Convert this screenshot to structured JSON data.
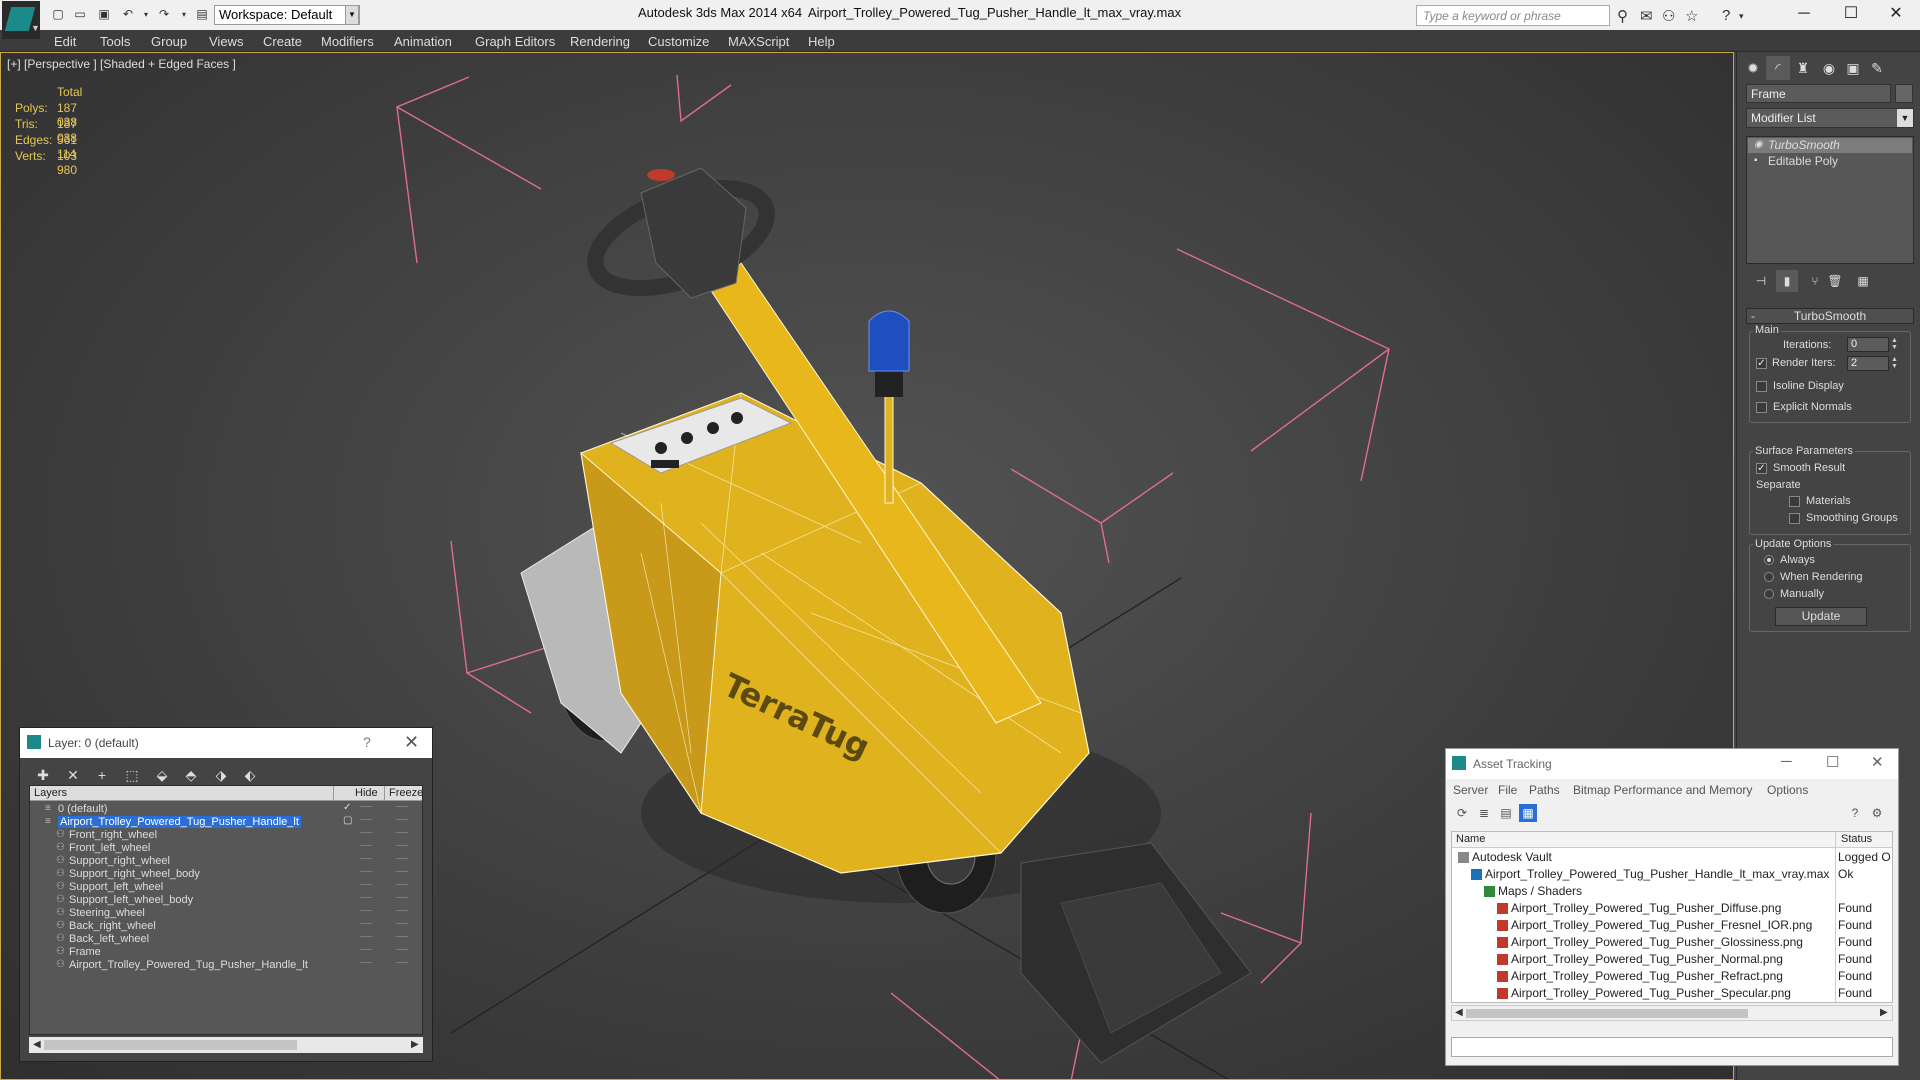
{
  "titlebar": {
    "workspace": "Workspace: Default",
    "app_title": "Autodesk 3ds Max  2014 x64",
    "file_title": "Airport_Trolley_Powered_Tug_Pusher_Handle_lt_max_vray.max",
    "search_placeholder": "Type a keyword or phrase"
  },
  "menu": [
    "Edit",
    "Tools",
    "Group",
    "Views",
    "Create",
    "Modifiers",
    "Animation",
    "Graph Editors",
    "Rendering",
    "Customize",
    "MAXScript",
    "Help"
  ],
  "viewport": {
    "label": "[+] [Perspective ] [Shaded + Edged Faces ]",
    "stats": {
      "header": "Total",
      "rows": [
        {
          "label": "Polys:",
          "value": "187 038"
        },
        {
          "label": "Tris:",
          "value": "187 038"
        },
        {
          "label": "Edges:",
          "value": "561 114"
        },
        {
          "label": "Verts:",
          "value": "103 980"
        }
      ]
    },
    "model_decal": "TerraTug"
  },
  "command_panel": {
    "object_name": "Frame",
    "modifier_list": "Modifier List",
    "stack": [
      "TurboSmooth",
      "Editable Poly"
    ],
    "turbosmooth": {
      "title": "TurboSmooth",
      "main_group": "Main",
      "iterations_label": "Iterations:",
      "iterations_value": "0",
      "render_iters_label": "Render Iters:",
      "render_iters_value": "2",
      "isoline": "Isoline Display",
      "explicit": "Explicit Normals",
      "surface_group": "Surface Parameters",
      "smooth_result": "Smooth Result",
      "separate": "Separate",
      "materials": "Materials",
      "smoothing_groups": "Smoothing Groups",
      "update_group": "Update Options",
      "always": "Always",
      "when_rendering": "When Rendering",
      "manually": "Manually",
      "update_button": "Update"
    }
  },
  "layer_dialog": {
    "title": "Layer: 0 (default)",
    "columns": [
      "Layers",
      "Hide",
      "Freeze"
    ],
    "rows": [
      {
        "name": "0 (default)",
        "level": 0,
        "selected": false
      },
      {
        "name": "Airport_Trolley_Powered_Tug_Pusher_Handle_lt",
        "level": 0,
        "selected": true
      },
      {
        "name": "Front_right_wheel",
        "level": 1,
        "selected": false
      },
      {
        "name": "Front_left_wheel",
        "level": 1,
        "selected": false
      },
      {
        "name": "Support_right_wheel",
        "level": 1,
        "selected": false
      },
      {
        "name": "Support_right_wheel_body",
        "level": 1,
        "selected": false
      },
      {
        "name": "Support_left_wheel",
        "level": 1,
        "selected": false
      },
      {
        "name": "Support_left_wheel_body",
        "level": 1,
        "selected": false
      },
      {
        "name": "Steering_wheel",
        "level": 1,
        "selected": false
      },
      {
        "name": "Back_right_wheel",
        "level": 1,
        "selected": false
      },
      {
        "name": "Back_left_wheel",
        "level": 1,
        "selected": false
      },
      {
        "name": "Frame",
        "level": 1,
        "selected": false
      },
      {
        "name": "Airport_Trolley_Powered_Tug_Pusher_Handle_lt",
        "level": 1,
        "selected": false
      }
    ]
  },
  "asset_tracking": {
    "title": "Asset Tracking",
    "menu": [
      "Server",
      "File",
      "Paths",
      "Bitmap Performance and Memory",
      "Options"
    ],
    "columns": [
      "Name",
      "Status"
    ],
    "rows": [
      {
        "name": "Autodesk Vault",
        "status": "Logged O",
        "level": 0
      },
      {
        "name": "Airport_Trolley_Powered_Tug_Pusher_Handle_lt_max_vray.max",
        "status": "Ok",
        "level": 1
      },
      {
        "name": "Maps / Shaders",
        "status": "",
        "level": 2
      },
      {
        "name": "Airport_Trolley_Powered_Tug_Pusher_Diffuse.png",
        "status": "Found",
        "level": 3
      },
      {
        "name": "Airport_Trolley_Powered_Tug_Pusher_Fresnel_IOR.png",
        "status": "Found",
        "level": 3
      },
      {
        "name": "Airport_Trolley_Powered_Tug_Pusher_Glossiness.png",
        "status": "Found",
        "level": 3
      },
      {
        "name": "Airport_Trolley_Powered_Tug_Pusher_Normal.png",
        "status": "Found",
        "level": 3
      },
      {
        "name": "Airport_Trolley_Powered_Tug_Pusher_Refract.png",
        "status": "Found",
        "level": 3
      },
      {
        "name": "Airport_Trolley_Powered_Tug_Pusher_Specular.png",
        "status": "Found",
        "level": 3
      }
    ]
  },
  "colors": {
    "accent": "#1d8a8a",
    "selection": "#2b6fd6",
    "stats": "#e6c657",
    "model_yellow": "#e0b21e",
    "bbox_pink": "#e06a9a"
  }
}
